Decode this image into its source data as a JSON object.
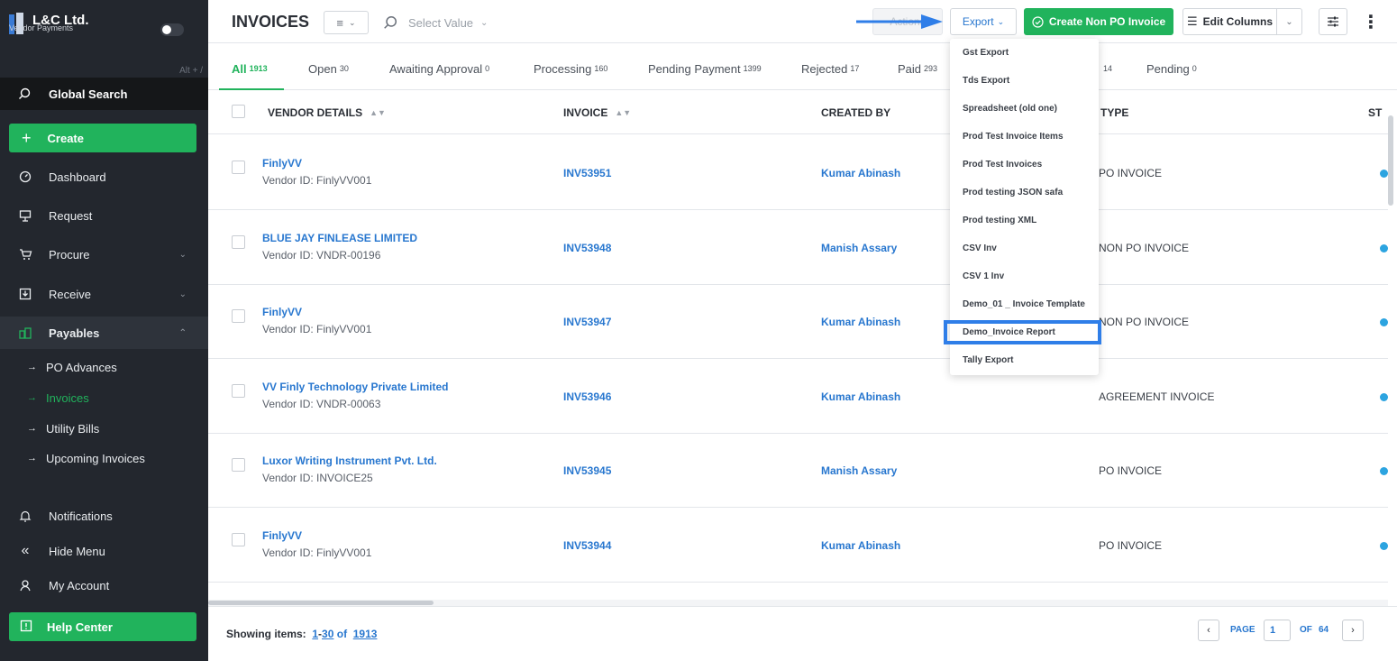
{
  "brand": {
    "title": "L&C Ltd.",
    "subtitle": "Vendor Payments",
    "shortcut": "Alt + /"
  },
  "sidebar": {
    "search_label": "Global Search",
    "create_label": "Create",
    "items": [
      {
        "label": "Dashboard"
      },
      {
        "label": "Request"
      },
      {
        "label": "Procure"
      },
      {
        "label": "Receive"
      },
      {
        "label": "Payables"
      }
    ],
    "payables_sub": [
      {
        "label": "PO Advances"
      },
      {
        "label": "Invoices"
      },
      {
        "label": "Utility Bills"
      },
      {
        "label": "Upcoming Invoices"
      }
    ],
    "bottom": [
      {
        "label": "Notifications"
      },
      {
        "label": "Hide Menu"
      },
      {
        "label": "My Account"
      }
    ],
    "help_label": "Help Center"
  },
  "header": {
    "title": "INVOICES",
    "select_placeholder": "Select Value",
    "actions_label": "Actions",
    "export_label": "Export",
    "create_label": "Create Non PO Invoice",
    "edit_columns_label": "Edit Columns"
  },
  "tabs": [
    {
      "label": "All",
      "count": "1913"
    },
    {
      "label": "Open",
      "count": "30"
    },
    {
      "label": "Awaiting Approval",
      "count": "0"
    },
    {
      "label": "Processing",
      "count": "160"
    },
    {
      "label": "Pending Payment",
      "count": "1399"
    },
    {
      "label": "Rejected",
      "count": "17"
    },
    {
      "label": "Paid",
      "count": "293"
    },
    {
      "label": "",
      "count": "14"
    },
    {
      "label": "Pending",
      "count": "0"
    }
  ],
  "table": {
    "columns": {
      "vendor": "VENDOR DETAILS",
      "invoice": "INVOICE",
      "created_by": "CREATED BY",
      "type": "TYPE",
      "status": "ST"
    },
    "rows": [
      {
        "vendor": "FinlyVV",
        "vendor_id": "Vendor ID: FinlyVV001",
        "invoice": "INV53951",
        "created_by": "Kumar Abinash",
        "type": "PO INVOICE"
      },
      {
        "vendor": "BLUE JAY FINLEASE LIMITED",
        "vendor_id": "Vendor ID: VNDR-00196",
        "invoice": "INV53948",
        "created_by": "Manish Assary",
        "type": "NON PO INVOICE"
      },
      {
        "vendor": "FinlyVV",
        "vendor_id": "Vendor ID: FinlyVV001",
        "invoice": "INV53947",
        "created_by": "Kumar Abinash",
        "type": "NON PO INVOICE"
      },
      {
        "vendor": "VV Finly Technology Private Limited",
        "vendor_id": "Vendor ID: VNDR-00063",
        "invoice": "INV53946",
        "created_by": "Kumar Abinash",
        "type": "AGREEMENT INVOICE"
      },
      {
        "vendor": "Luxor Writing Instrument Pvt. Ltd.",
        "vendor_id": "Vendor ID: INVOICE25",
        "invoice": "INV53945",
        "created_by": "Manish Assary",
        "type": "PO INVOICE"
      },
      {
        "vendor": "FinlyVV",
        "vendor_id": "Vendor ID: FinlyVV001",
        "invoice": "INV53944",
        "created_by": "Kumar Abinash",
        "type": "PO INVOICE"
      }
    ]
  },
  "export_menu": [
    "Gst Export",
    "Tds Export",
    "Spreadsheet (old one)",
    "Prod Test Invoice Items",
    "Prod Test Invoices",
    "Prod testing JSON safa",
    "Prod testing XML",
    "CSV Inv",
    "CSV 1 Inv",
    "Demo_01 _ Invoice Template",
    "Demo_Invoice Report",
    "Tally Export"
  ],
  "footer": {
    "showing_label": "Showing items:",
    "range_start": "1",
    "range_end": "30",
    "of_label": "of",
    "total": "1913",
    "page_label": "PAGE",
    "page": "1",
    "of_pages_label": "OF",
    "total_pages": "64"
  },
  "colors": {
    "accent": "#21b35c",
    "link": "#2877cf",
    "sidebar": "#23272e",
    "highlight": "#2f7ee8"
  }
}
